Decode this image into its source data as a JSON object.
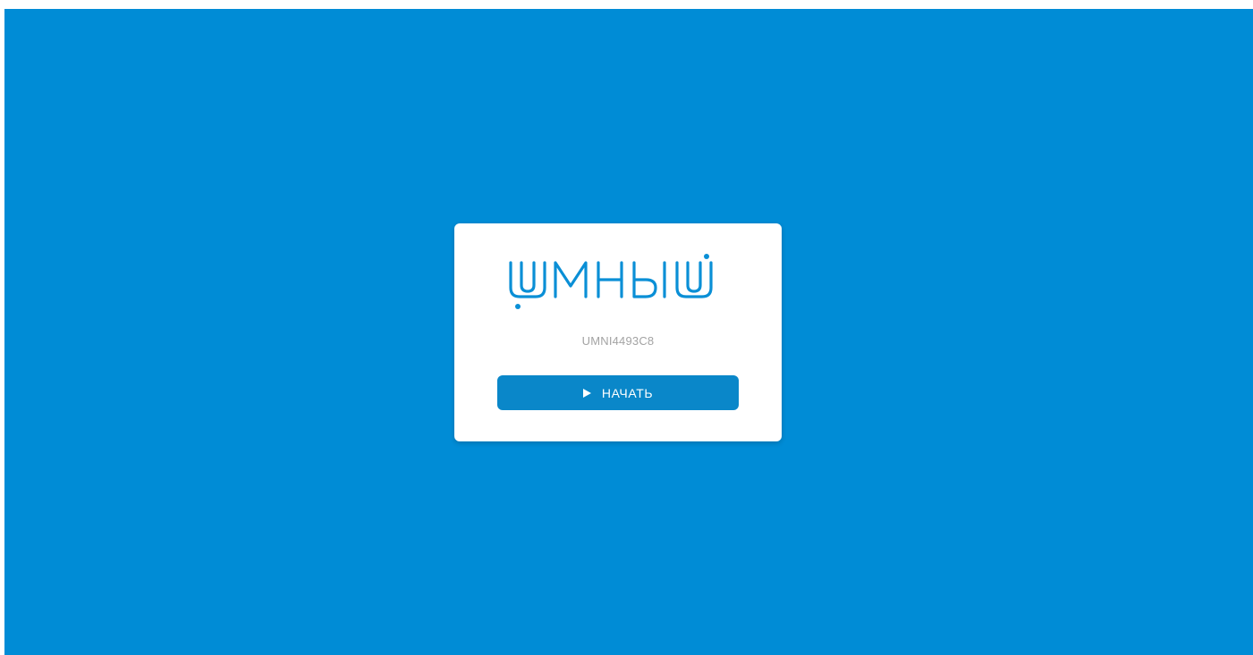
{
  "colors": {
    "background": "#008cd6",
    "card": "#ffffff",
    "brand": "#0a8fd6",
    "button": "#0a87c9",
    "device_id_text": "#a3a3a3"
  },
  "logo": {
    "text": "ЩМНЫЙ",
    "icon": "umnyi-logo"
  },
  "device": {
    "id": "UMNI4493C8"
  },
  "start_button": {
    "icon": "play-icon",
    "label": "НАЧАТЬ"
  }
}
